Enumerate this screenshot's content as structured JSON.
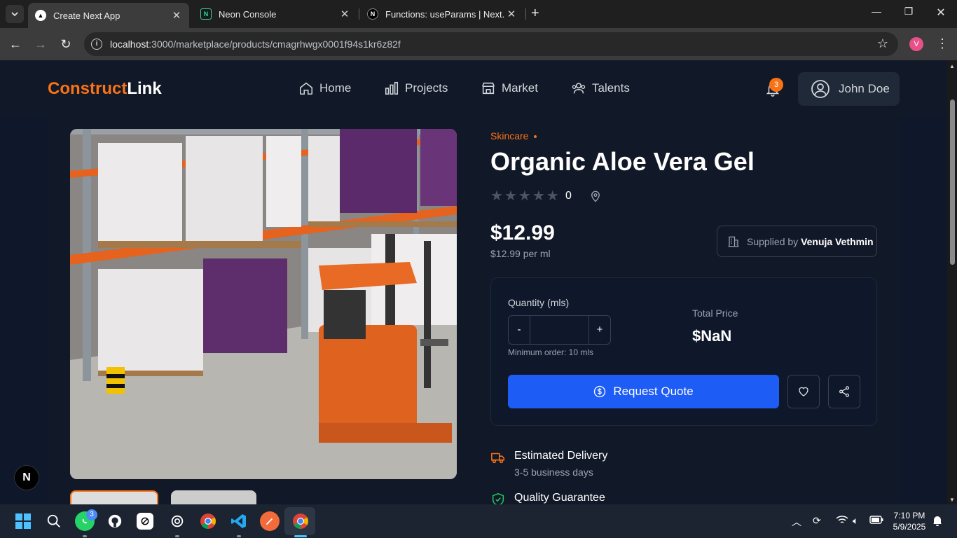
{
  "browser": {
    "tabs": [
      {
        "title": "Create Next App",
        "active": true
      },
      {
        "title": "Neon Console",
        "active": false
      },
      {
        "title": "Functions: useParams | Next.js",
        "active": false
      }
    ],
    "url_host": "localhost",
    "url_rest": ":3000/marketplace/products/cmagrhwgx0001f94s1kr6z82f",
    "profile_initial": "V"
  },
  "site": {
    "logo_part1": "Construct",
    "logo_part2": "Link",
    "nav": [
      {
        "label": "Home",
        "icon": "home-icon"
      },
      {
        "label": "Projects",
        "icon": "bar-chart-icon"
      },
      {
        "label": "Market",
        "icon": "store-icon"
      },
      {
        "label": "Talents",
        "icon": "users-icon"
      }
    ],
    "notification_count": "3",
    "user_name": "John Doe"
  },
  "product": {
    "category": "Skincare",
    "title": "Organic Aloe Vera Gel",
    "rating_count": "0",
    "rating": 0,
    "price": "$12.99",
    "unit_price": "$12.99 per ml",
    "supplier_prefix": "Supplied by",
    "supplier_name": "Venuja Vethmin",
    "quantity_label": "Quantity (mls)",
    "quantity_value": "",
    "minus": "-",
    "plus": "+",
    "min_order": "Minimum order: 10 mls",
    "total_label": "Total Price",
    "total_value": "$NaN",
    "quote_button": "Request Quote",
    "features": [
      {
        "title": "Estimated Delivery",
        "subtitle": "3-5 business days"
      },
      {
        "title": "Quality Guarantee",
        "subtitle": ""
      }
    ]
  },
  "dev_badge": "N",
  "taskbar": {
    "whatsapp_badge": "3",
    "time": "7:10 PM",
    "date": "5/9/2025"
  },
  "colors": {
    "accent": "#f97316",
    "primary_button": "#1d5cf5",
    "background": "#0f172a"
  }
}
